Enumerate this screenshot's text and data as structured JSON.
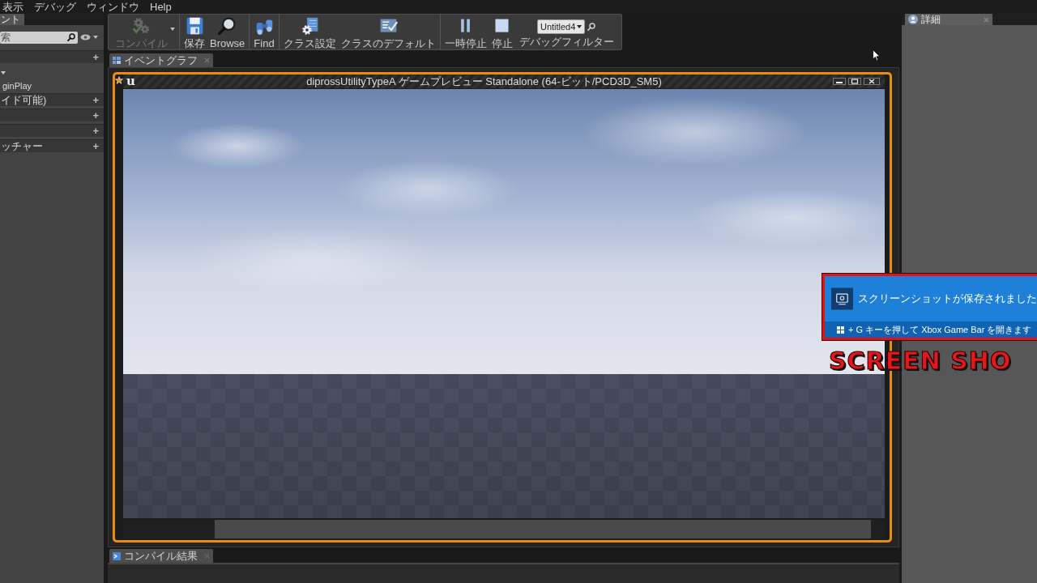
{
  "menu_bar": {
    "items": [
      "表示",
      "デバッグ",
      "ウィンドウ",
      "Help"
    ]
  },
  "left_panel": {
    "tab": {
      "label": "ント",
      "selected": true
    },
    "search": {
      "placeholder": "索"
    },
    "sections": [
      {
        "add": "+",
        "tree": [
          {
            "expanded": true,
            "children": [
              {
                "label": "ginPlay"
              }
            ]
          }
        ]
      },
      {
        "label": "イド可能)",
        "add": "+"
      },
      {
        "add": "+"
      },
      {
        "add": "+"
      },
      {
        "label": "ッチャー",
        "add": "+"
      }
    ]
  },
  "toolbar": {
    "groups": [
      {
        "buttons": [
          {
            "kind": "compile",
            "label": "コンパイル",
            "disabled": true
          }
        ]
      },
      {
        "buttons": [
          {
            "kind": "save",
            "label": "保存",
            "disabled": false
          },
          {
            "kind": "browse",
            "label": "Browse",
            "disabled": false
          }
        ]
      },
      {
        "buttons": [
          {
            "kind": "find",
            "label": "Find",
            "disabled": false
          }
        ]
      },
      {
        "buttons": [
          {
            "kind": "class-settings",
            "label": "クラス設定",
            "disabled": false
          },
          {
            "kind": "class-defaults",
            "label": "クラスのデフォルト",
            "disabled": false
          }
        ]
      },
      {
        "buttons": [
          {
            "kind": "pause",
            "label": "一時停止",
            "disabled": false
          },
          {
            "kind": "stop",
            "label": "停止",
            "disabled": false
          }
        ]
      }
    ],
    "debug_filter": {
      "value": "Untitled4",
      "label": "デバッグフィルター"
    }
  },
  "graph_tabs": [
    {
      "label": "イベントグラフ",
      "selected": true
    }
  ],
  "preview_window": {
    "logo": "u",
    "title": "diprossUtilityTypeA ゲームプレビュー Standalone (64-ビット/PCD3D_SM5)"
  },
  "bottom_tabs": [
    {
      "label": "コンパイル結果",
      "selected": true
    }
  ],
  "details_panel": {
    "tabs": [
      {
        "label": "詳細",
        "selected": true
      }
    ]
  },
  "notification": {
    "message": "スクリーンショットが保存されました",
    "hint": "+ G キーを押して Xbox Game Bar を開きます"
  },
  "caption": "SCREEN SHO"
}
